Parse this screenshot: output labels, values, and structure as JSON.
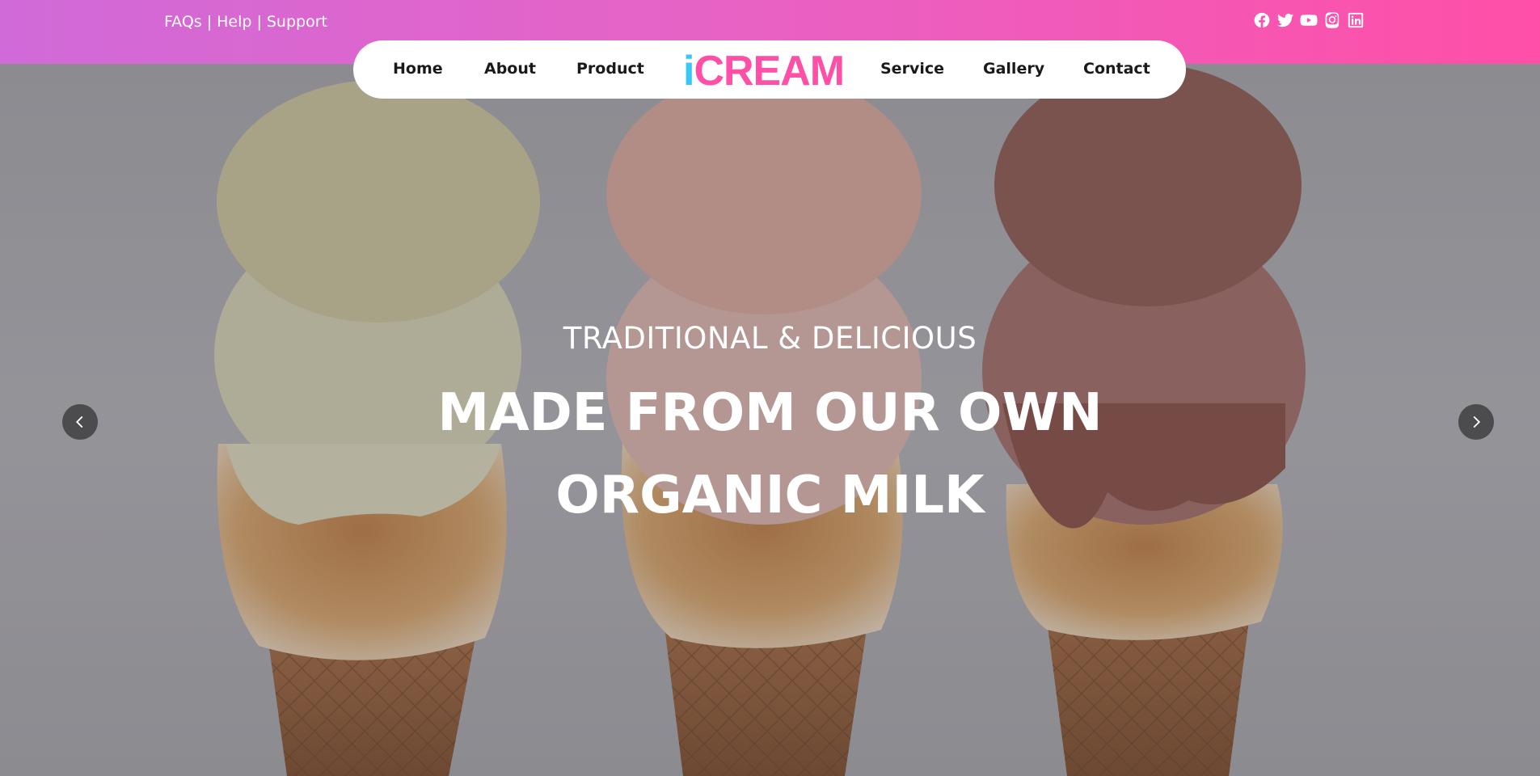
{
  "topbar": {
    "links": [
      "FAQs",
      "Help",
      "Support"
    ],
    "separator": "|",
    "socials": [
      "facebook-icon",
      "twitter-icon",
      "youtube-icon",
      "instagram-icon",
      "linkedin-icon"
    ],
    "gradient": [
      "#d06ad8",
      "#ff4fa7"
    ]
  },
  "nav": {
    "items_left": [
      "Home",
      "About",
      "Product"
    ],
    "items_right": [
      "Service",
      "Gallery",
      "Contact"
    ],
    "logo_first": "i",
    "logo_rest": "CREAM",
    "logo_colors": {
      "i": "#38c6f4",
      "rest": "#ff4fa7"
    }
  },
  "hero": {
    "subtitle": "TRADITIONAL & DELICIOUS",
    "title_line1": "MADE FROM OUR OWN",
    "title_line2": "ORGANIC MILK",
    "prev_icon": "chevron-left-icon",
    "next_icon": "chevron-right-icon"
  }
}
